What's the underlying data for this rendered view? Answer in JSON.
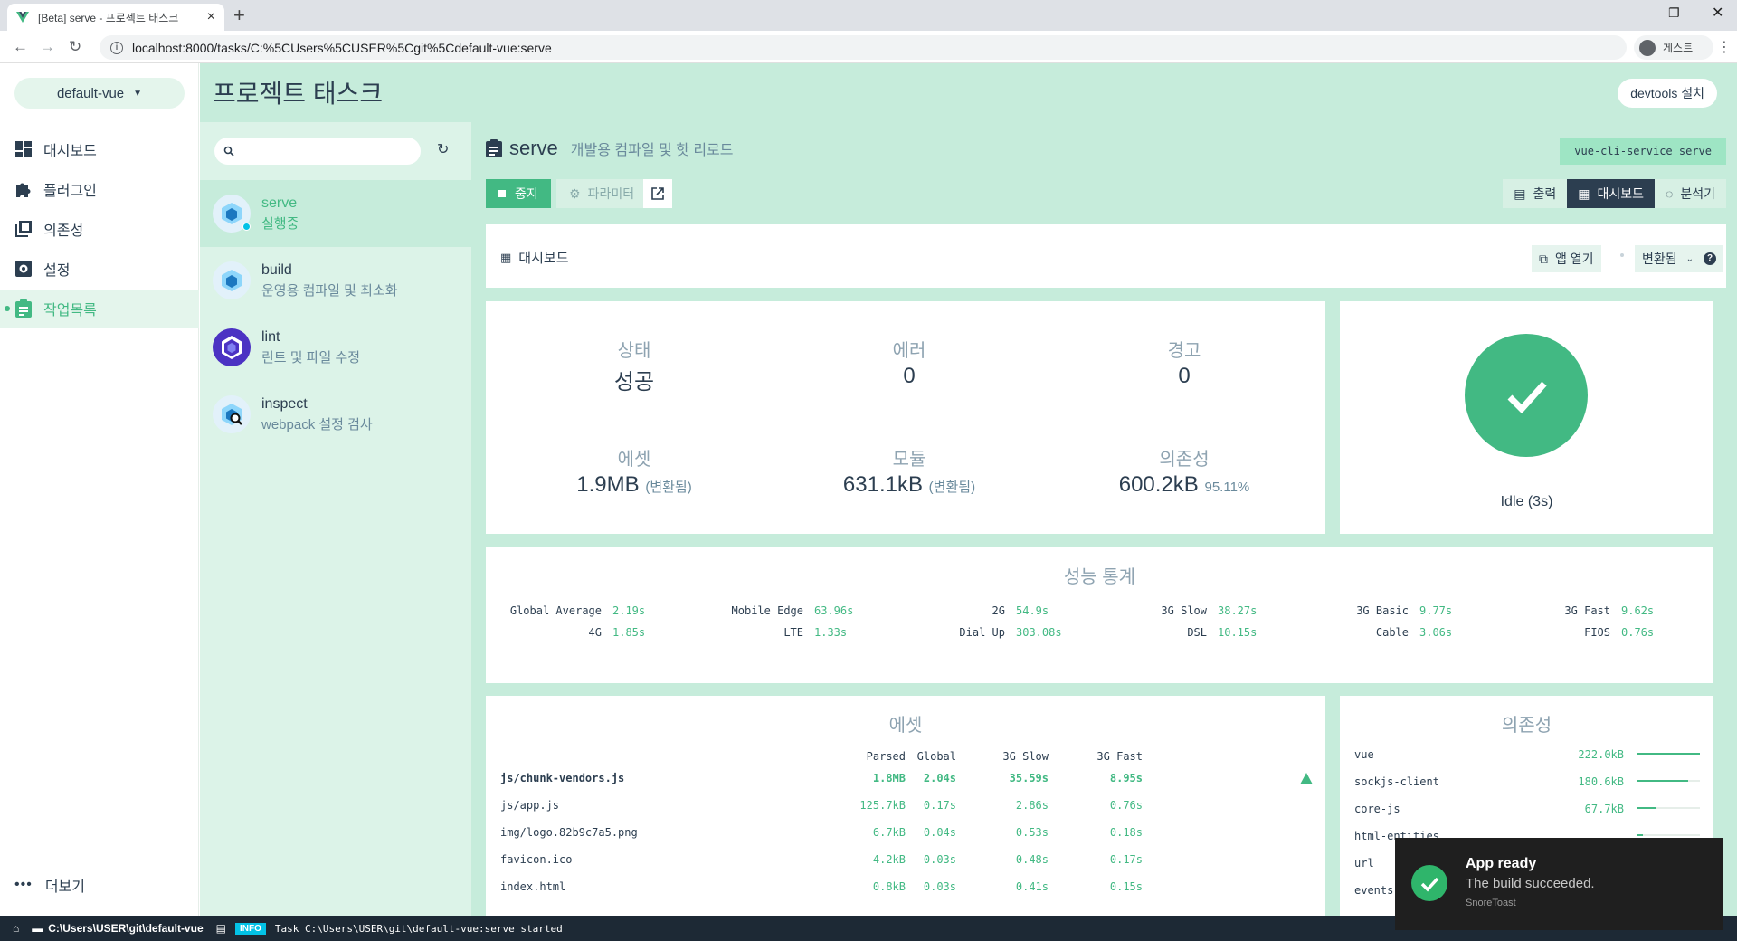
{
  "browser": {
    "tab_title": "[Beta] serve - 프로젝트 태스크",
    "url": "localhost:8000/tasks/C:%5CUsers%5CUSER%5Cgit%5Cdefault-vue:serve",
    "profile": "게스트"
  },
  "sidebar": {
    "project": "default-vue",
    "items": [
      {
        "label": "대시보드",
        "icon": "dashboard-icon"
      },
      {
        "label": "플러그인",
        "icon": "puzzle-icon"
      },
      {
        "label": "의존성",
        "icon": "library-icon"
      },
      {
        "label": "설정",
        "icon": "gear-icon"
      },
      {
        "label": "작업목록",
        "icon": "clipboard-icon"
      }
    ],
    "more": "더보기"
  },
  "header": {
    "title": "프로젝트 태스크",
    "devtools": "devtools 설치"
  },
  "tasks": [
    {
      "name": "serve",
      "desc": "실행중"
    },
    {
      "name": "build",
      "desc": "운영용 컴파일 및 최소화"
    },
    {
      "name": "lint",
      "desc": "린트 및 파일 수정"
    },
    {
      "name": "inspect",
      "desc": "webpack 설정 검사"
    }
  ],
  "detail": {
    "name": "serve",
    "desc": "개발용 컴파일 및 핫 리로드",
    "command": "vue-cli-service serve",
    "stop": "중지",
    "params": "파라미터",
    "views": [
      "출력",
      "대시보드",
      "분석기"
    ],
    "dash_label": "대시보드",
    "open_app": "앱 열기",
    "mode": "변환됨"
  },
  "status": {
    "state_k": "상태",
    "state_v": "성공",
    "errors_k": "에러",
    "errors_v": "0",
    "warnings_k": "경고",
    "warnings_v": "0",
    "assets_k": "에셋",
    "assets_v": "1.9MB",
    "assets_s": "(변환됨)",
    "modules_k": "모듈",
    "modules_v": "631.1kB",
    "modules_s": "(변환됨)",
    "deps_k": "의존성",
    "deps_v": "600.2kB",
    "deps_s": "95.11%",
    "idle": "Idle (3s)"
  },
  "speed": {
    "title": "성능 통계",
    "row1": [
      {
        "n": "Global Average",
        "t": "2.19s"
      },
      {
        "n": "Mobile Edge",
        "t": "63.96s"
      },
      {
        "n": "2G",
        "t": "54.9s"
      },
      {
        "n": "3G Slow",
        "t": "38.27s"
      },
      {
        "n": "3G Basic",
        "t": "9.77s"
      },
      {
        "n": "3G Fast",
        "t": "9.62s"
      }
    ],
    "row2": [
      {
        "n": "4G",
        "t": "1.85s"
      },
      {
        "n": "LTE",
        "t": "1.33s"
      },
      {
        "n": "Dial Up",
        "t": "303.08s"
      },
      {
        "n": "DSL",
        "t": "10.15s"
      },
      {
        "n": "Cable",
        "t": "3.06s"
      },
      {
        "n": "FIOS",
        "t": "0.76s"
      }
    ]
  },
  "assets": {
    "title": "에셋",
    "cols": [
      "Parsed",
      "Global",
      "3G Slow",
      "3G Fast"
    ],
    "rows": [
      {
        "name": "js/chunk-vendors.js",
        "v": [
          "1.8MB",
          "2.04s",
          "35.59s",
          "8.95s"
        ]
      },
      {
        "name": "js/app.js",
        "v": [
          "125.7kB",
          "0.17s",
          "2.86s",
          "0.76s"
        ]
      },
      {
        "name": "img/logo.82b9c7a5.png",
        "v": [
          "6.7kB",
          "0.04s",
          "0.53s",
          "0.18s"
        ]
      },
      {
        "name": "favicon.ico",
        "v": [
          "4.2kB",
          "0.03s",
          "0.48s",
          "0.17s"
        ]
      },
      {
        "name": "index.html",
        "v": [
          "0.8kB",
          "0.03s",
          "0.41s",
          "0.15s"
        ]
      }
    ]
  },
  "deps": {
    "title": "의존성",
    "rows": [
      {
        "name": "vue",
        "size": "222.0kB",
        "ratio": 1.0
      },
      {
        "name": "sockjs-client",
        "size": "180.6kB",
        "ratio": 0.81
      },
      {
        "name": "core-js",
        "size": "67.7kB",
        "ratio": 0.3
      },
      {
        "name": "html-entities",
        "size": "",
        "ratio": 0.1
      },
      {
        "name": "url",
        "size": "",
        "ratio": 0.08
      },
      {
        "name": "events",
        "size": "",
        "ratio": 0.05
      }
    ]
  },
  "statusbar": {
    "path": "C:\\Users\\USER\\git\\default-vue",
    "level": "INFO",
    "log": "Task C:\\Users\\USER\\git\\default-vue:serve started"
  },
  "toast": {
    "title": "App ready",
    "body": "The build succeeded.",
    "source": "SnoreToast"
  },
  "colors": {
    "accent": "#42b983",
    "bg": "#c6ecdb",
    "dark": "#2c3e50"
  }
}
